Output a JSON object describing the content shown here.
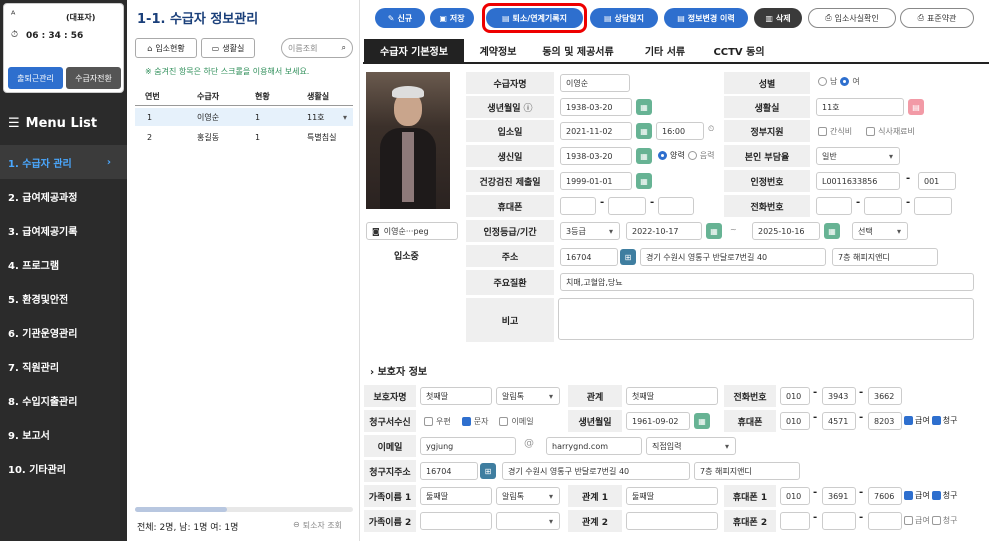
{
  "sidebar": {
    "user_name": "(대표자)",
    "timer": "06 : 34 : 56",
    "btn_attendance": "출퇴근관리",
    "btn_switch": "수급자전환",
    "menu_title": "Menu List",
    "items": [
      "1. 수급자 관리",
      "2. 급여제공과정",
      "3. 급여제공기록",
      "4. 프로그램",
      "5. 환경및안전",
      "6. 기관운영관리",
      "7. 직원관리",
      "8. 수입지출관리",
      "9. 보고서",
      "10. 기타관리"
    ]
  },
  "list": {
    "title": "1-1. 수급자 정보관리",
    "btn_status": "입소현황",
    "btn_room": "생활실",
    "search_label": "이름조회",
    "hint": "※ 숨겨진 항목은 하단 스크롤을 이용해서 보세요.",
    "headers": [
      "연번",
      "수급자",
      "현황",
      "생활실"
    ],
    "rows": [
      [
        "1",
        "이영순",
        "1",
        "11호"
      ],
      [
        "2",
        "홍길동",
        "1",
        "특별침실"
      ]
    ],
    "footer": "전체: 2명, 남: 1명 여: 1명",
    "footer_btn": "퇴소자 조회"
  },
  "toolbar": {
    "new": "신규",
    "save": "저장",
    "discharge": "퇴소/연계기록지",
    "consult": "상담일지",
    "history": "정보변경 이력",
    "delete": "삭제",
    "admission_confirm": "입소사실확인",
    "standard_terms": "표준약관"
  },
  "tabs": [
    "수급자 기본정보",
    "계약정보",
    "동의 및 제공서류",
    "기타 서류",
    "CCTV 동의"
  ],
  "photo": {
    "file": "이영순···peg",
    "status": "입소중"
  },
  "basic": {
    "l_name": "수급자명",
    "name": "이영순",
    "l_gender": "성별",
    "gender_m": "남",
    "gender_f": "여",
    "l_birth": "생년월일",
    "birth": "1938-03-20",
    "l_room": "생활실",
    "room": "11호",
    "l_admit": "입소일",
    "admit_date": "2021-11-02",
    "admit_time": "16:00",
    "l_support": "정부지원",
    "support1": "간식비",
    "support2": "식사재료비",
    "l_birthday": "생신일",
    "birthday": "1938-03-20",
    "cal_solar": "양력",
    "cal_lunar": "음력",
    "l_burden": "본인 부담율",
    "burden": "일반",
    "l_health": "건강검진 제출일",
    "health": "1999-01-01",
    "l_certno": "인정번호",
    "certno": "L0011633856",
    "certno2": "001",
    "l_mobile": "휴대폰",
    "l_phone": "전화번호",
    "l_grade": "인정등급/기간",
    "grade": "3등급",
    "grade_from": "2022-10-17",
    "tilde": "~",
    "grade_to": "2025-10-16",
    "grade_sel": "선택",
    "l_addr": "주소",
    "zip": "16704",
    "addr1": "경기 수원시 영통구 반달로7번길 40",
    "addr2": "7층 해피지앤디",
    "l_disease": "주요질환",
    "disease": "치매,고혈압,당뇨",
    "l_note": "비고"
  },
  "guardian": {
    "title": "보호자 정보",
    "l_name": "보호자명",
    "name": "첫째딸",
    "relation_sel": "알림톡",
    "l_relation": "관계",
    "relation": "첫째딸",
    "l_phone": "전화번호",
    "phone1": "010",
    "phone2": "3943",
    "phone3": "3662",
    "l_bill": "청구서수신",
    "bill_mail": "우편",
    "bill_sms": "문자",
    "bill_email": "이메일",
    "l_birth": "생년월일",
    "birth": "1961-09-02",
    "l_mobile": "휴대폰",
    "mobile1": "010",
    "mobile2": "4571",
    "mobile3": "8203",
    "chk_pay": "급여",
    "chk_bill": "청구",
    "l_email": "이메일",
    "email_id": "ygjung",
    "at": "@",
    "email_domain": "harrygnd.com",
    "email_sel": "직접입력",
    "l_billaddr": "청구지주소",
    "zip": "16704",
    "addr1": "경기 수원시 영통구 반달로7번길 40",
    "addr2": "7층 해피지앤디",
    "l_family1": "가족이름 1",
    "family1": "둘째딸",
    "family1_sel": "알림톡",
    "l_rel1": "관계 1",
    "rel1": "둘째딸",
    "l_fmobile1": "휴대폰 1",
    "fm1a": "010",
    "fm1b": "3691",
    "fm1c": "7606",
    "l_family2": "가족이름 2",
    "l_rel2": "관계 2",
    "l_fmobile2": "휴대폰 2"
  },
  "colors": {
    "accent": "#2e6fce",
    "sidebar": "#2b2b2b",
    "calendar": "#67b394"
  }
}
